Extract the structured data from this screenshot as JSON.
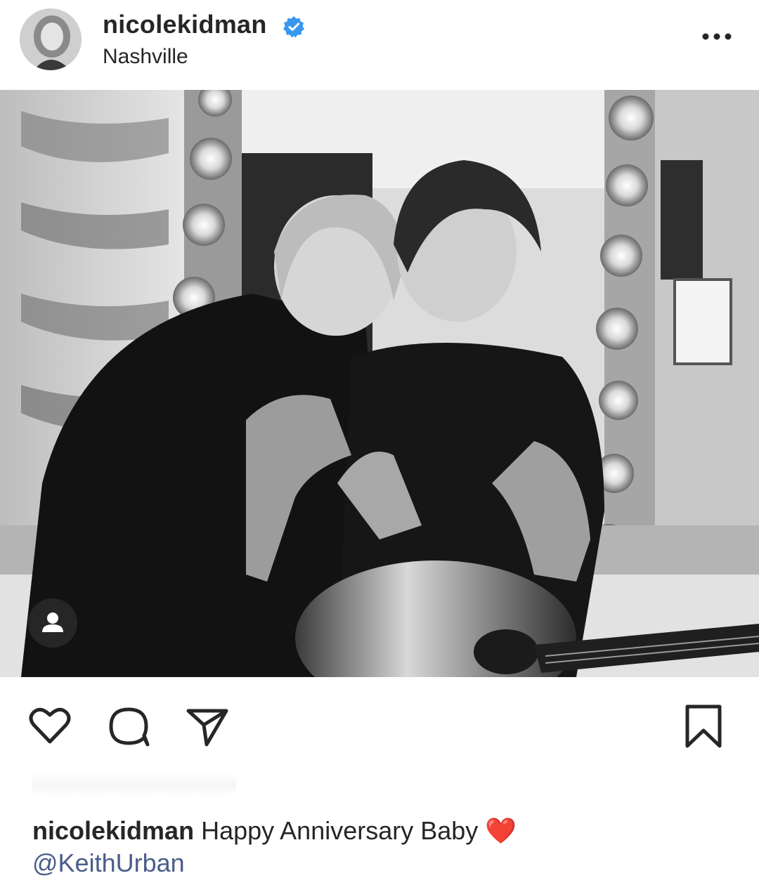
{
  "post": {
    "username": "nicolekidman",
    "location": "Nashville",
    "verified": true,
    "more_icon": "more-horizontal-icon"
  },
  "photo": {
    "description_icon": "photo",
    "tag_icon": "user-tag-icon"
  },
  "actions": {
    "like_icon": "heart-icon",
    "comment_icon": "comment-icon",
    "share_icon": "send-icon",
    "save_icon": "bookmark-icon"
  },
  "caption": {
    "username": "nicolekidman",
    "text": "Happy Anniversary Baby",
    "emoji": "❤️",
    "mention": "@KeithUrban"
  },
  "colors": {
    "text": "#262626",
    "verified_blue": "#3897f0",
    "mention": "#4a5d8a",
    "heart": "#e0162b"
  }
}
